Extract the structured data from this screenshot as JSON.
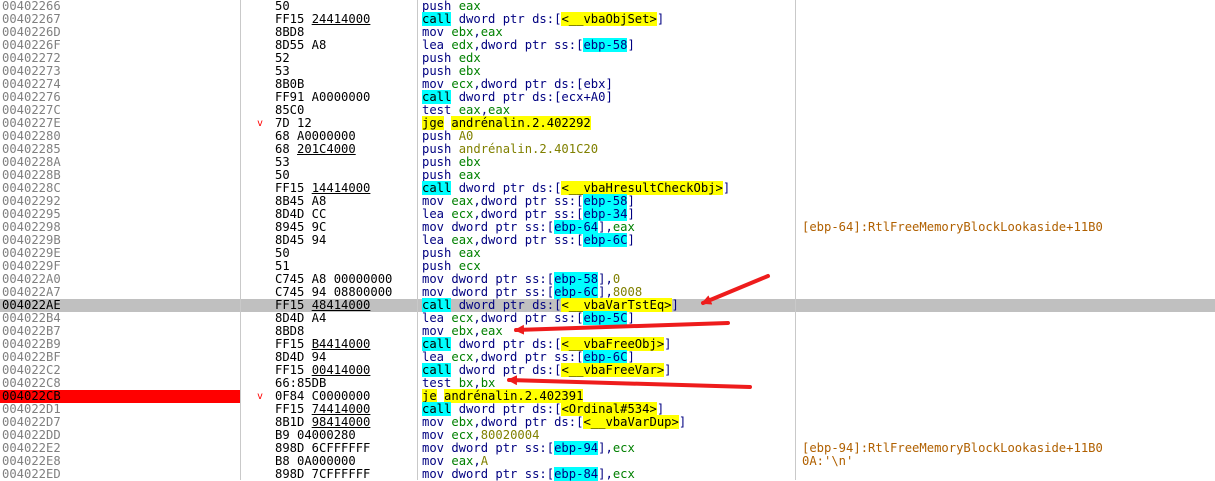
{
  "columns": [
    "address",
    "bytes",
    "disassembly",
    "comment"
  ],
  "accent_colors": {
    "highlight_row": "#c0c0c0",
    "current_address": "#ff0000",
    "call": "#00ffff",
    "jump": "#ffff00",
    "arrow": "#ee1c1c"
  },
  "rows": [
    {
      "addr": "00402266",
      "bytes": [
        {
          "t": "50"
        }
      ],
      "ins": [
        {
          "t": "push ",
          "c": "i"
        },
        {
          "t": "eax",
          "c": "r"
        }
      ]
    },
    {
      "addr": "00402267",
      "bytes": [
        {
          "t": "FF15 "
        },
        {
          "t": "24414000",
          "u": true
        }
      ],
      "ins": [
        {
          "t": "call",
          "c": "call"
        },
        {
          "t": " dword ptr ",
          "c": "i"
        },
        {
          "t": "ds:",
          "c": "m"
        },
        {
          "t": "[",
          "c": "m"
        },
        {
          "t": "<__vbaObjSet>",
          "c": "lbl"
        },
        {
          "t": "]",
          "c": "m"
        }
      ]
    },
    {
      "addr": "0040226D",
      "bytes": [
        {
          "t": "8BD8"
        }
      ],
      "ins": [
        {
          "t": "mov ",
          "c": "i"
        },
        {
          "t": "ebx",
          "c": "r"
        },
        {
          "t": ",",
          "c": "i"
        },
        {
          "t": "eax",
          "c": "r"
        }
      ]
    },
    {
      "addr": "0040226F",
      "bytes": [
        {
          "t": "8D55 A8"
        }
      ],
      "ins": [
        {
          "t": "lea ",
          "c": "i"
        },
        {
          "t": "edx",
          "c": "r"
        },
        {
          "t": ",dword ptr ",
          "c": "i"
        },
        {
          "t": "ss:",
          "c": "m"
        },
        {
          "t": "[",
          "c": "m"
        },
        {
          "t": "ebp-58",
          "c": "ms"
        },
        {
          "t": "]",
          "c": "m"
        }
      ]
    },
    {
      "addr": "00402272",
      "bytes": [
        {
          "t": "52"
        }
      ],
      "ins": [
        {
          "t": "push ",
          "c": "i"
        },
        {
          "t": "edx",
          "c": "r"
        }
      ]
    },
    {
      "addr": "00402273",
      "bytes": [
        {
          "t": "53"
        }
      ],
      "ins": [
        {
          "t": "push ",
          "c": "i"
        },
        {
          "t": "ebx",
          "c": "r"
        }
      ]
    },
    {
      "addr": "00402274",
      "bytes": [
        {
          "t": "8B0B"
        }
      ],
      "ins": [
        {
          "t": "mov ",
          "c": "i"
        },
        {
          "t": "ecx",
          "c": "r"
        },
        {
          "t": ",dword ptr ",
          "c": "i"
        },
        {
          "t": "ds:",
          "c": "m"
        },
        {
          "t": "[ebx]",
          "c": "m"
        }
      ]
    },
    {
      "addr": "00402276",
      "bytes": [
        {
          "t": "FF91 A0000000"
        }
      ],
      "ins": [
        {
          "t": "call",
          "c": "call"
        },
        {
          "t": " dword ptr ",
          "c": "i"
        },
        {
          "t": "ds:",
          "c": "m"
        },
        {
          "t": "[ecx+A0]",
          "c": "m"
        }
      ]
    },
    {
      "addr": "0040227C",
      "bytes": [
        {
          "t": "85C0"
        }
      ],
      "ins": [
        {
          "t": "test ",
          "c": "i"
        },
        {
          "t": "eax",
          "c": "r"
        },
        {
          "t": ",",
          "c": "i"
        },
        {
          "t": "eax",
          "c": "r"
        }
      ]
    },
    {
      "addr": "0040227E",
      "jmp": "v",
      "bytes": [
        {
          "t": "7D 12"
        }
      ],
      "ins": [
        {
          "t": "jge",
          "c": "jx"
        },
        {
          "t": " ",
          "c": "i"
        },
        {
          "t": "andrénalin.2.402292",
          "c": "lbl"
        }
      ]
    },
    {
      "addr": "00402280",
      "bytes": [
        {
          "t": "68 A0000000"
        }
      ],
      "ins": [
        {
          "t": "push ",
          "c": "i"
        },
        {
          "t": "A0",
          "c": "n"
        }
      ]
    },
    {
      "addr": "00402285",
      "bytes": [
        {
          "t": "68 "
        },
        {
          "t": "201C4000",
          "u": true
        }
      ],
      "ins": [
        {
          "t": "push ",
          "c": "i"
        },
        {
          "t": "andrénalin.2.401C20",
          "c": "n"
        }
      ]
    },
    {
      "addr": "0040228A",
      "bytes": [
        {
          "t": "53"
        }
      ],
      "ins": [
        {
          "t": "push ",
          "c": "i"
        },
        {
          "t": "ebx",
          "c": "r"
        }
      ]
    },
    {
      "addr": "0040228B",
      "bytes": [
        {
          "t": "50"
        }
      ],
      "ins": [
        {
          "t": "push ",
          "c": "i"
        },
        {
          "t": "eax",
          "c": "r"
        }
      ]
    },
    {
      "addr": "0040228C",
      "bytes": [
        {
          "t": "FF15 "
        },
        {
          "t": "14414000",
          "u": true
        }
      ],
      "ins": [
        {
          "t": "call",
          "c": "call"
        },
        {
          "t": " dword ptr ",
          "c": "i"
        },
        {
          "t": "ds:",
          "c": "m"
        },
        {
          "t": "[",
          "c": "m"
        },
        {
          "t": "<__vbaHresultCheckObj>",
          "c": "lbl"
        },
        {
          "t": "]",
          "c": "m"
        }
      ]
    },
    {
      "addr": "00402292",
      "bytes": [
        {
          "t": "8B45 A8"
        }
      ],
      "ins": [
        {
          "t": "mov ",
          "c": "i"
        },
        {
          "t": "eax",
          "c": "r"
        },
        {
          "t": ",dword ptr ",
          "c": "i"
        },
        {
          "t": "ss:",
          "c": "m"
        },
        {
          "t": "[",
          "c": "m"
        },
        {
          "t": "ebp-58",
          "c": "ms"
        },
        {
          "t": "]",
          "c": "m"
        }
      ]
    },
    {
      "addr": "00402295",
      "bytes": [
        {
          "t": "8D4D CC"
        }
      ],
      "ins": [
        {
          "t": "lea ",
          "c": "i"
        },
        {
          "t": "ecx",
          "c": "r"
        },
        {
          "t": ",dword ptr ",
          "c": "i"
        },
        {
          "t": "ss:",
          "c": "m"
        },
        {
          "t": "[",
          "c": "m"
        },
        {
          "t": "ebp-34",
          "c": "ms"
        },
        {
          "t": "]",
          "c": "m"
        }
      ]
    },
    {
      "addr": "00402298",
      "bytes": [
        {
          "t": "8945 9C"
        }
      ],
      "ins": [
        {
          "t": "mov dword ptr ",
          "c": "i"
        },
        {
          "t": "ss:",
          "c": "m"
        },
        {
          "t": "[",
          "c": "m"
        },
        {
          "t": "ebp-64",
          "c": "ms"
        },
        {
          "t": "]",
          "c": "m"
        },
        {
          "t": ",",
          "c": "i"
        },
        {
          "t": "eax",
          "c": "r"
        }
      ],
      "cmt": "[ebp-64]:RtlFreeMemoryBlockLookaside+11B0"
    },
    {
      "addr": "0040229B",
      "bytes": [
        {
          "t": "8D45 94"
        }
      ],
      "ins": [
        {
          "t": "lea ",
          "c": "i"
        },
        {
          "t": "eax",
          "c": "r"
        },
        {
          "t": ",dword ptr ",
          "c": "i"
        },
        {
          "t": "ss:",
          "c": "m"
        },
        {
          "t": "[",
          "c": "m"
        },
        {
          "t": "ebp-6C",
          "c": "ms"
        },
        {
          "t": "]",
          "c": "m"
        }
      ]
    },
    {
      "addr": "0040229E",
      "bytes": [
        {
          "t": "50"
        }
      ],
      "ins": [
        {
          "t": "push ",
          "c": "i"
        },
        {
          "t": "eax",
          "c": "r"
        }
      ]
    },
    {
      "addr": "0040229F",
      "bytes": [
        {
          "t": "51"
        }
      ],
      "ins": [
        {
          "t": "push ",
          "c": "i"
        },
        {
          "t": "ecx",
          "c": "r"
        }
      ]
    },
    {
      "addr": "004022A0",
      "bytes": [
        {
          "t": "C745 A8 00000000"
        }
      ],
      "ins": [
        {
          "t": "mov dword ptr ",
          "c": "i"
        },
        {
          "t": "ss:",
          "c": "m"
        },
        {
          "t": "[",
          "c": "m"
        },
        {
          "t": "ebp-58",
          "c": "ms"
        },
        {
          "t": "]",
          "c": "m"
        },
        {
          "t": ",",
          "c": "i"
        },
        {
          "t": "0",
          "c": "n"
        }
      ]
    },
    {
      "addr": "004022A7",
      "bytes": [
        {
          "t": "C745 94 08800000"
        }
      ],
      "ins": [
        {
          "t": "mov dword ptr ",
          "c": "i"
        },
        {
          "t": "ss:",
          "c": "m"
        },
        {
          "t": "[",
          "c": "m"
        },
        {
          "t": "ebp-6C",
          "c": "ms"
        },
        {
          "t": "]",
          "c": "m"
        },
        {
          "t": ",",
          "c": "i"
        },
        {
          "t": "8008",
          "c": "n"
        }
      ]
    },
    {
      "addr": "004022AE",
      "sel": true,
      "bytes": [
        {
          "t": "FF15 "
        },
        {
          "t": "48414000",
          "u": true
        }
      ],
      "ins": [
        {
          "t": "call",
          "c": "call"
        },
        {
          "t": " dword ptr ",
          "c": "i"
        },
        {
          "t": "ds:",
          "c": "m"
        },
        {
          "t": "[",
          "c": "m"
        },
        {
          "t": "<__vbaVarTstEq>",
          "c": "lbl"
        },
        {
          "t": "]",
          "c": "m"
        }
      ]
    },
    {
      "addr": "004022B4",
      "bytes": [
        {
          "t": "8D4D A4"
        }
      ],
      "ins": [
        {
          "t": "lea ",
          "c": "i"
        },
        {
          "t": "ecx",
          "c": "r"
        },
        {
          "t": ",dword ptr ",
          "c": "i"
        },
        {
          "t": "ss:",
          "c": "m"
        },
        {
          "t": "[",
          "c": "m"
        },
        {
          "t": "ebp-5C",
          "c": "ms"
        },
        {
          "t": "]",
          "c": "m"
        }
      ]
    },
    {
      "addr": "004022B7",
      "bytes": [
        {
          "t": "8BD8"
        }
      ],
      "ins": [
        {
          "t": "mov ",
          "c": "i"
        },
        {
          "t": "ebx",
          "c": "r"
        },
        {
          "t": ",",
          "c": "i"
        },
        {
          "t": "eax",
          "c": "r"
        }
      ]
    },
    {
      "addr": "004022B9",
      "bytes": [
        {
          "t": "FF15 "
        },
        {
          "t": "B4414000",
          "u": true
        }
      ],
      "ins": [
        {
          "t": "call",
          "c": "call"
        },
        {
          "t": " dword ptr ",
          "c": "i"
        },
        {
          "t": "ds:",
          "c": "m"
        },
        {
          "t": "[",
          "c": "m"
        },
        {
          "t": "<__vbaFreeObj>",
          "c": "lbl"
        },
        {
          "t": "]",
          "c": "m"
        }
      ]
    },
    {
      "addr": "004022BF",
      "bytes": [
        {
          "t": "8D4D 94"
        }
      ],
      "ins": [
        {
          "t": "lea ",
          "c": "i"
        },
        {
          "t": "ecx",
          "c": "r"
        },
        {
          "t": ",dword ptr ",
          "c": "i"
        },
        {
          "t": "ss:",
          "c": "m"
        },
        {
          "t": "[",
          "c": "m"
        },
        {
          "t": "ebp-6C",
          "c": "ms"
        },
        {
          "t": "]",
          "c": "m"
        }
      ]
    },
    {
      "addr": "004022C2",
      "bytes": [
        {
          "t": "FF15 "
        },
        {
          "t": "00414000",
          "u": true
        }
      ],
      "ins": [
        {
          "t": "call",
          "c": "call"
        },
        {
          "t": " dword ptr ",
          "c": "i"
        },
        {
          "t": "ds:",
          "c": "m"
        },
        {
          "t": "[",
          "c": "m"
        },
        {
          "t": "<__vbaFreeVar>",
          "c": "lbl"
        },
        {
          "t": "]",
          "c": "m"
        }
      ]
    },
    {
      "addr": "004022C8",
      "bytes": [
        {
          "t": "66:85DB"
        }
      ],
      "ins": [
        {
          "t": "test ",
          "c": "i"
        },
        {
          "t": "bx",
          "c": "r"
        },
        {
          "t": ",",
          "c": "i"
        },
        {
          "t": "bx",
          "c": "r"
        }
      ]
    },
    {
      "addr": "004022CB",
      "cur": true,
      "jmp": "v",
      "bytes": [
        {
          "t": "0F84 C0000000"
        }
      ],
      "ins": [
        {
          "t": "je",
          "c": "jx"
        },
        {
          "t": " ",
          "c": "i"
        },
        {
          "t": "andrénalin.2.402391",
          "c": "lbl"
        }
      ]
    },
    {
      "addr": "004022D1",
      "bytes": [
        {
          "t": "FF15 "
        },
        {
          "t": "74414000",
          "u": true
        }
      ],
      "ins": [
        {
          "t": "call",
          "c": "call"
        },
        {
          "t": " dword ptr ",
          "c": "i"
        },
        {
          "t": "ds:",
          "c": "m"
        },
        {
          "t": "[",
          "c": "m"
        },
        {
          "t": "<Ordinal#534>",
          "c": "lbl"
        },
        {
          "t": "]",
          "c": "m"
        }
      ]
    },
    {
      "addr": "004022D7",
      "bytes": [
        {
          "t": "8B1D "
        },
        {
          "t": "98414000",
          "u": true
        }
      ],
      "ins": [
        {
          "t": "mov ",
          "c": "i"
        },
        {
          "t": "ebx",
          "c": "r"
        },
        {
          "t": ",dword ptr ",
          "c": "i"
        },
        {
          "t": "ds:",
          "c": "m"
        },
        {
          "t": "[",
          "c": "m"
        },
        {
          "t": "<__vbaVarDup>",
          "c": "lbl"
        },
        {
          "t": "]",
          "c": "m"
        }
      ]
    },
    {
      "addr": "004022DD",
      "bytes": [
        {
          "t": "B9 04000280"
        }
      ],
      "ins": [
        {
          "t": "mov ",
          "c": "i"
        },
        {
          "t": "ecx",
          "c": "r"
        },
        {
          "t": ",",
          "c": "i"
        },
        {
          "t": "80020004",
          "c": "n"
        }
      ]
    },
    {
      "addr": "004022E2",
      "bytes": [
        {
          "t": "898D 6CFFFFFF"
        }
      ],
      "ins": [
        {
          "t": "mov dword ptr ",
          "c": "i"
        },
        {
          "t": "ss:",
          "c": "m"
        },
        {
          "t": "[",
          "c": "m"
        },
        {
          "t": "ebp-94",
          "c": "ms"
        },
        {
          "t": "]",
          "c": "m"
        },
        {
          "t": ",",
          "c": "i"
        },
        {
          "t": "ecx",
          "c": "r"
        }
      ],
      "cmt": "[ebp-94]:RtlFreeMemoryBlockLookaside+11B0"
    },
    {
      "addr": "004022E8",
      "bytes": [
        {
          "t": "B8 0A000000"
        }
      ],
      "ins": [
        {
          "t": "mov ",
          "c": "i"
        },
        {
          "t": "eax",
          "c": "r"
        },
        {
          "t": ",",
          "c": "i"
        },
        {
          "t": "A",
          "c": "n"
        }
      ],
      "cmt": "0A:'\\n'"
    },
    {
      "addr": "004022ED",
      "bytes": [
        {
          "t": "898D 7CFFFFFF"
        }
      ],
      "ins": [
        {
          "t": "mov dword ptr ",
          "c": "i"
        },
        {
          "t": "ss:",
          "c": "m"
        },
        {
          "t": "[",
          "c": "m"
        },
        {
          "t": "ebp-84",
          "c": "ms"
        },
        {
          "t": "]",
          "c": "m"
        },
        {
          "t": ",",
          "c": "i"
        },
        {
          "t": "ecx",
          "c": "r"
        }
      ]
    }
  ],
  "annotations": [
    {
      "name": "arrow-vbaVarTstEq",
      "points_to_row": 22
    },
    {
      "name": "arrow-mov-ebx-eax",
      "points_to_row": 24
    },
    {
      "name": "arrow-test-bx-bx",
      "points_to_row": 28
    }
  ]
}
